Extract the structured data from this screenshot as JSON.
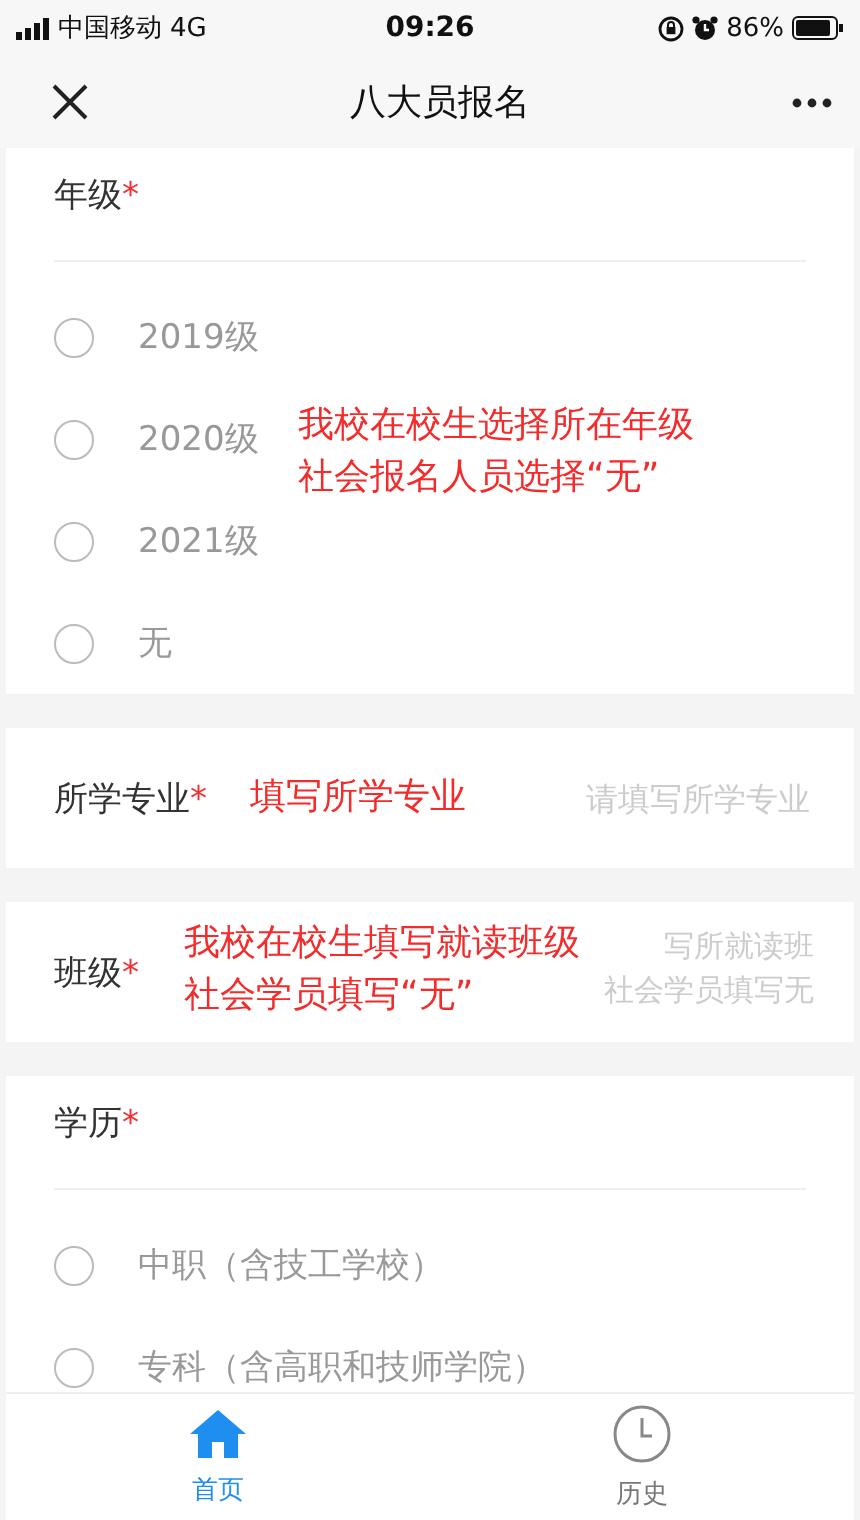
{
  "status_bar": {
    "carrier": "中国移动",
    "network": "4G",
    "time": "09:26",
    "battery": "86%"
  },
  "nav": {
    "title": "八大员报名"
  },
  "sections": [
    {
      "kind": "radio",
      "label": "年级",
      "required_mark": "*",
      "options": [
        {
          "label": "2019级",
          "selected": false
        },
        {
          "label": "2020级",
          "selected": false
        },
        {
          "label": "2021级",
          "selected": false
        },
        {
          "label": "无",
          "selected": false
        }
      ],
      "annotation": [
        "我校在校生选择所在年级",
        "社会报名人员选择“无”"
      ]
    },
    {
      "kind": "input",
      "label": "所学专业",
      "required_mark": "*",
      "placeholder": "请填写所学专业",
      "annotation": [
        "填写所学专业"
      ]
    },
    {
      "kind": "textarea",
      "label": "班级",
      "required_mark": "*",
      "placeholder": [
        "写所就读班",
        "社会学员填写无"
      ],
      "annotation": [
        "我校在校生填写就读班级",
        "社会学员填写“无”"
      ]
    },
    {
      "kind": "radio",
      "label": "学历",
      "required_mark": "*",
      "options": [
        {
          "label": "中职（含技工学校）",
          "selected": false
        },
        {
          "label": "专科（含高职和技师学院）",
          "selected": false
        }
      ]
    }
  ],
  "tabs": [
    {
      "kind": "home",
      "label": "首页",
      "selected": true
    },
    {
      "kind": "history",
      "label": "历史",
      "selected": false
    }
  ]
}
